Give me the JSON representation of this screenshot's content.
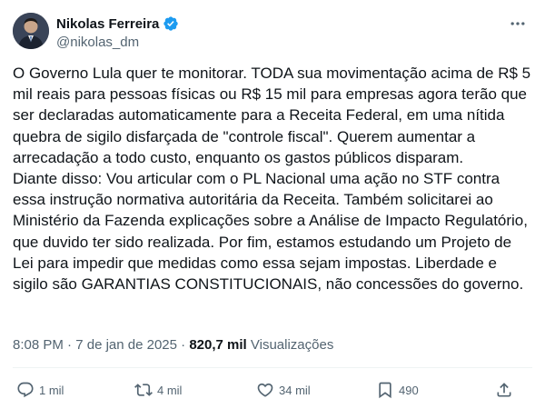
{
  "author": {
    "name": "Nikolas Ferreira",
    "handle": "@nikolas_dm",
    "verified": true
  },
  "more_icon": "more-icon",
  "post": {
    "paragraph1": "O Governo Lula quer te monitorar. TODA sua movimentação acima de R$ 5 mil reais para pessoas físicas ou R$ 15 mil para empresas agora terão que ser declaradas automaticamente para a Receita Federal, em uma nítida quebra de sigilo disfarçada de \"controle fiscal\". Querem aumentar a arrecadação a todo custo, enquanto os gastos públicos disparam.",
    "paragraph2": "Diante disso: Vou articular com o PL Nacional uma ação no STF contra essa instrução normativa autoritária da Receita. Também solicitarei ao Ministério da Fazenda explicações sobre a Análise de Impacto Regulatório, que duvido ter sido realizada. Por fim, estamos estudando um Projeto de Lei para impedir que medidas como essa sejam impostas. Liberdade e sigilo são GARANTIAS CONSTITUCIONAIS, não concessões do governo."
  },
  "meta": {
    "time": "8:08 PM",
    "separator": "·",
    "date": "7 de jan de 2025",
    "views_count": "820,7 mil",
    "views_label": "Visualizações"
  },
  "actions": {
    "replies": "1 mil",
    "reposts": "4 mil",
    "likes": "34 mil",
    "bookmarks": "490"
  },
  "colors": {
    "verified": "#1d9bf0",
    "text": "#0f1419",
    "secondary": "#536471"
  }
}
